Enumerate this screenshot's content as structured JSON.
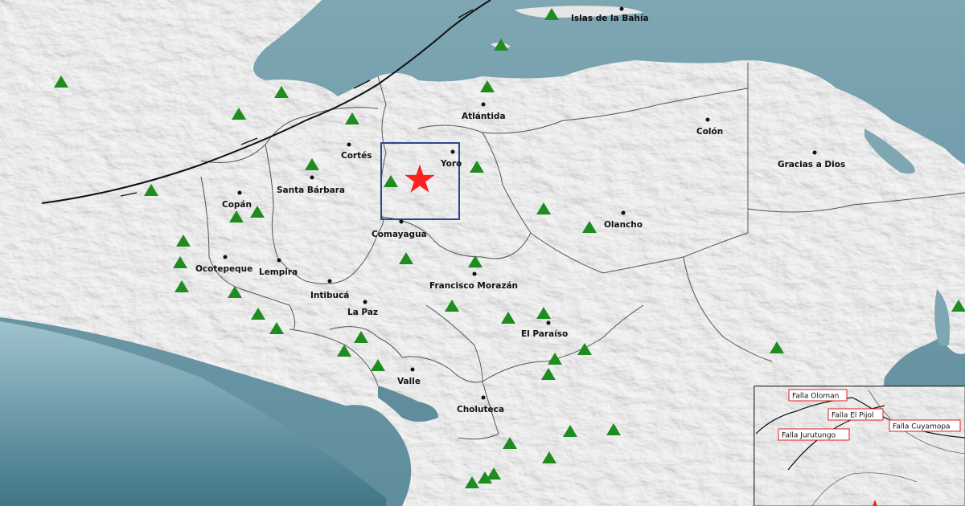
{
  "map": {
    "departments": [
      {
        "name": "Islas de la Bahía"
      },
      {
        "name": "Atlántida"
      },
      {
        "name": "Cortés"
      },
      {
        "name": "Yoro"
      },
      {
        "name": "Colón"
      },
      {
        "name": "Gracias a Dios"
      },
      {
        "name": "Santa Bárbara"
      },
      {
        "name": "Copán"
      },
      {
        "name": "Comayagua"
      },
      {
        "name": "Olancho"
      },
      {
        "name": "Ocotepeque"
      },
      {
        "name": "Lempira"
      },
      {
        "name": "Intibucá"
      },
      {
        "name": "La Paz"
      },
      {
        "name": "Francisco Morazán"
      },
      {
        "name": "El Paraíso"
      },
      {
        "name": "Valle"
      },
      {
        "name": "Choluteca"
      }
    ],
    "inset_faults": [
      "Falla Oloman",
      "Falla El Pijol",
      "Falla Cuyamopa",
      "Falla Jurutungo"
    ],
    "colors": {
      "sea": "#8fb4bf",
      "land": "#eeeeee",
      "station": "#1e8c1e",
      "epicenter": "#ff2020",
      "focus_box": "#2a4a8a"
    }
  }
}
